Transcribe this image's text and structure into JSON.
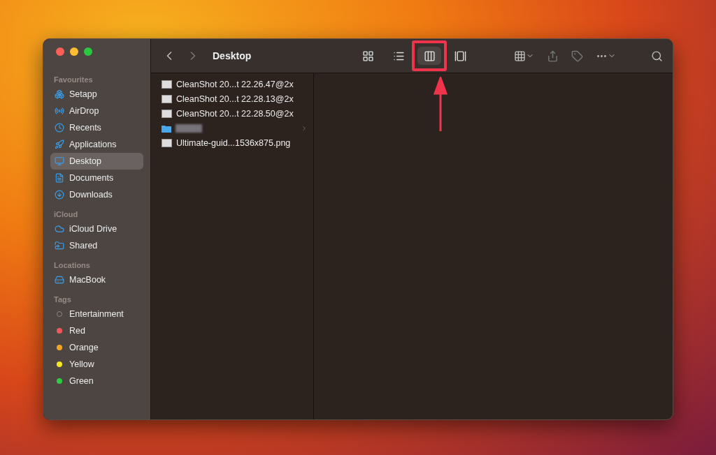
{
  "window": {
    "title": "Desktop"
  },
  "toolbar": {
    "view_modes": [
      {
        "selected": false
      },
      {
        "selected": false
      },
      {
        "selected": true
      },
      {
        "selected": false
      }
    ],
    "highlight_selected_view": true
  },
  "sidebar": {
    "sections": [
      {
        "heading": "Favourites",
        "items": [
          {
            "label": "Setapp",
            "selected": false
          },
          {
            "label": "AirDrop",
            "selected": false
          },
          {
            "label": "Recents",
            "selected": false
          },
          {
            "label": "Applications",
            "selected": false
          },
          {
            "label": "Desktop",
            "selected": true
          },
          {
            "label": "Documents",
            "selected": false
          },
          {
            "label": "Downloads",
            "selected": false
          }
        ]
      },
      {
        "heading": "iCloud",
        "items": [
          {
            "label": "iCloud Drive",
            "selected": false
          },
          {
            "label": "Shared",
            "selected": false
          }
        ]
      },
      {
        "heading": "Locations",
        "items": [
          {
            "label": "MacBook",
            "selected": false
          }
        ]
      },
      {
        "heading": "Tags",
        "items": [
          {
            "label": "Entertainment",
            "selected": false,
            "kind": "tag",
            "color": "#8b8580",
            "outline": true
          },
          {
            "label": "Red",
            "selected": false,
            "kind": "tag",
            "color": "#f0585b",
            "outline": false
          },
          {
            "label": "Orange",
            "selected": false,
            "kind": "tag",
            "color": "#f5a623",
            "outline": false
          },
          {
            "label": "Yellow",
            "selected": false,
            "kind": "tag",
            "color": "#f8e71c",
            "outline": false
          },
          {
            "label": "Green",
            "selected": false,
            "kind": "tag",
            "color": "#2ecc40",
            "outline": false
          }
        ]
      }
    ]
  },
  "files": [
    {
      "kind": "image",
      "name": "CleanShot 20...t 22.26.47@2x"
    },
    {
      "kind": "image",
      "name": "CleanShot 20...t 22.28.13@2x"
    },
    {
      "kind": "image",
      "name": "CleanShot 20...t 22.28.50@2x"
    },
    {
      "kind": "folder"
    },
    {
      "kind": "image",
      "name": "Ultimate-guid...1536x875.png"
    }
  ]
}
